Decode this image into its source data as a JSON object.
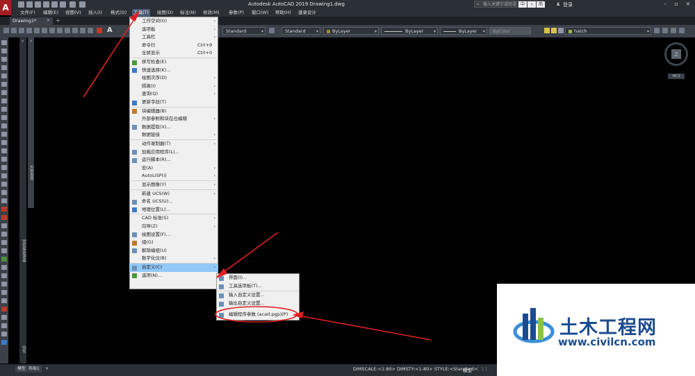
{
  "app": {
    "title": "Autodesk AutoCAD 2019    Drawing1.dwg",
    "logo": "A"
  },
  "search": {
    "placeholder": "输入关键字或短语"
  },
  "ime": [
    "中",
    "ゝ",
    "简"
  ],
  "account": {
    "login": "登录"
  },
  "menubar": [
    "文件(F)",
    "编辑(E)",
    "视图(V)",
    "插入(I)",
    "格式(O)",
    "工具(T)",
    "绘图(D)",
    "标注(N)",
    "修改(M)",
    "参数(P)",
    "窗口(W)",
    "帮助(H)",
    "速录设计"
  ],
  "tab": {
    "name": "Drawing1*",
    "close": "×",
    "add": "+"
  },
  "properties": {
    "textstyle": "Standard",
    "dimstyle": "Standard",
    "layer_color": "ByLayer",
    "linetype": "ByLayer",
    "lineweight": "ByLayer",
    "plotstyle": "ByColor",
    "layer": "hatch",
    "annotation_glyph": "A"
  },
  "palettes": {
    "tool_palette": "外部参照",
    "properties_palette": "图纸集管理器",
    "x": "×",
    "info": "特性"
  },
  "tools_menu": {
    "items": [
      {
        "label": "工作空间(O)",
        "shortcut": "",
        "submenu": true
      },
      {
        "label": "选项板",
        "shortcut": "",
        "submenu": true
      },
      {
        "label": "工具栏",
        "shortcut": "",
        "submenu": true
      },
      {
        "label": "命令行",
        "shortcut": "Ctrl+9",
        "submenu": false
      },
      {
        "label": "全屏显示",
        "shortcut": "Ctrl+0",
        "submenu": false
      },
      {
        "label": "拼写检查(E)",
        "shortcut": "",
        "submenu": false
      },
      {
        "label": "快速选择(K)...",
        "shortcut": "",
        "submenu": false
      },
      {
        "label": "绘图次序(D)",
        "shortcut": "",
        "submenu": true
      },
      {
        "label": "隔离(I)",
        "shortcut": "",
        "submenu": true
      },
      {
        "label": "查询(Q)",
        "shortcut": "",
        "submenu": true
      },
      {
        "label": "更新字段(T)",
        "shortcut": "",
        "submenu": false
      },
      {
        "label": "块编辑器(B)",
        "shortcut": "",
        "submenu": false
      },
      {
        "label": "外部参照和块在位编辑",
        "shortcut": "",
        "submenu": true
      },
      {
        "label": "数据提取(X)...",
        "shortcut": "",
        "submenu": false
      },
      {
        "label": "数据链接",
        "shortcut": "",
        "submenu": true
      },
      {
        "label": "动作录制器(T)",
        "shortcut": "",
        "submenu": true
      },
      {
        "label": "加载应用程序(L)...",
        "shortcut": "",
        "submenu": false
      },
      {
        "label": "运行脚本(R)...",
        "shortcut": "",
        "submenu": false
      },
      {
        "label": "宏(A)",
        "shortcut": "",
        "submenu": true
      },
      {
        "label": "AutoLISP(I)",
        "shortcut": "",
        "submenu": true
      },
      {
        "label": "显示图像(Y)",
        "shortcut": "",
        "submenu": true
      },
      {
        "label": "新建 UCS(W)",
        "shortcut": "",
        "submenu": true
      },
      {
        "label": "命名 UCS(U)...",
        "shortcut": "",
        "submenu": false
      },
      {
        "label": "地理位置(L)...",
        "shortcut": "",
        "submenu": false
      },
      {
        "label": "CAD 标准(S)",
        "shortcut": "",
        "submenu": true
      },
      {
        "label": "向导(Z)",
        "shortcut": "",
        "submenu": true
      },
      {
        "label": "绘图设置(F)...",
        "shortcut": "",
        "submenu": false
      },
      {
        "label": "组(G)",
        "shortcut": "",
        "submenu": false
      },
      {
        "label": "解除编组(U)",
        "shortcut": "",
        "submenu": false
      },
      {
        "label": "数字化仪(B)",
        "shortcut": "",
        "submenu": true
      },
      {
        "label": "自定义(C)",
        "shortcut": "",
        "submenu": true
      },
      {
        "label": "选项(N)...",
        "shortcut": "",
        "submenu": false
      }
    ],
    "highlighted": "自定义(C)"
  },
  "customize_submenu": [
    "界面(I)...",
    "工具选项板(T)...",
    "输入自定义设置...",
    "输出自定义设置...",
    "编辑程序参数 (acad.pgp)(P)"
  ],
  "viewcube": {
    "face": "上",
    "wcs": "WCS"
  },
  "statusbar": {
    "tabs": [
      "模型",
      "布局1",
      "+"
    ],
    "text": "DIMSCALE:<1:80> DIMSTY:<1-80> STYLE:<Standard>",
    "model": "模型"
  },
  "watermark": {
    "title": "土木工程网",
    "url": "www.civilcn.com"
  },
  "colors": {
    "accent_highlight": "#91c9f7",
    "annotation_red": "#e02020",
    "brand_blue": "#1b4c8f"
  }
}
